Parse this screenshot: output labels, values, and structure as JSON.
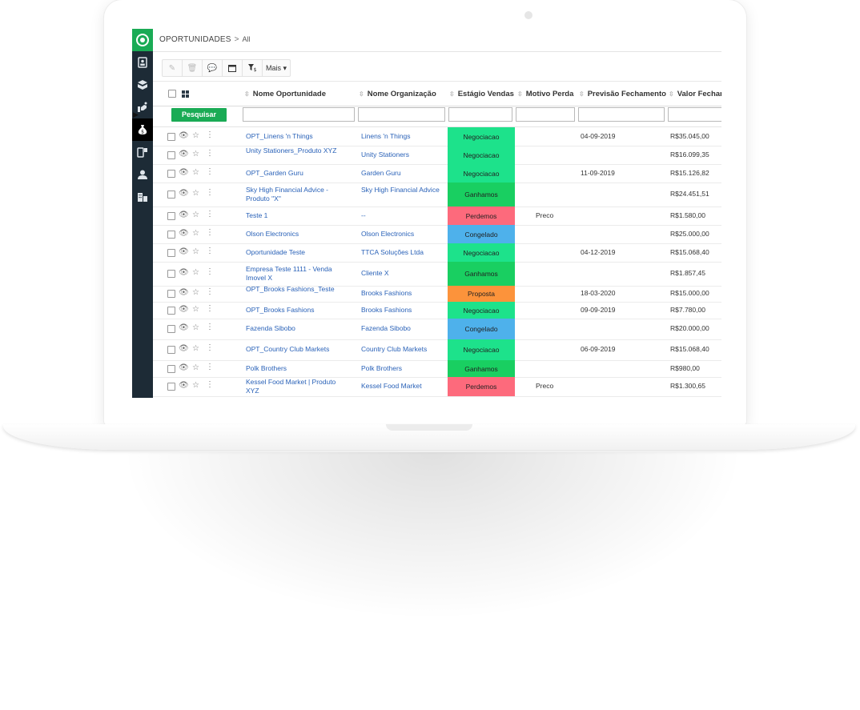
{
  "breadcrumb": {
    "main": "OPORTUNIDADES",
    "sep": ">",
    "sub": "All"
  },
  "toolbar": {
    "more_label": "Mais ▾"
  },
  "columns": [
    "Nome Oportunidade",
    "Nome Organização",
    "Estágio Vendas",
    "Motivo Perda",
    "Previsão Fechamento",
    "Valor Fechan"
  ],
  "filter": {
    "search_label": "Pesquisar"
  },
  "rows": [
    {
      "name": "OPT_Linens 'n Things",
      "org": "Linens 'n Things",
      "stage": "Negociacao",
      "reason": "",
      "date": "04-09-2019",
      "value": "R$35.045,00"
    },
    {
      "name": "Unity Stationers_Produto XYZ",
      "org": "Unity Stationers",
      "stage": "Negociacao",
      "reason": "",
      "date": "",
      "value": "R$16.099,35"
    },
    {
      "name": "OPT_Garden Guru",
      "org": "Garden Guru",
      "stage": "Negociacao",
      "reason": "",
      "date": "11-09-2019",
      "value": "R$15.126,82"
    },
    {
      "name": "Sky High Financial Advice - Produto \"X\"",
      "org": "Sky High Financial Advice",
      "stage": "Ganhamos",
      "reason": "",
      "date": "",
      "value": "R$24.451,51"
    },
    {
      "name": "Teste 1",
      "org": "--",
      "stage": "Perdemos",
      "reason": "Preco",
      "date": "",
      "value": "R$1.580,00"
    },
    {
      "name": "Olson Electronics",
      "org": "Olson Electronics",
      "stage": "Congelado",
      "reason": "",
      "date": "",
      "value": "R$25.000,00"
    },
    {
      "name": "Oportunidade Teste",
      "org": "TTCA Soluções Ltda",
      "stage": "Negociacao",
      "reason": "",
      "date": "04-12-2019",
      "value": "R$15.068,40"
    },
    {
      "name": "Empresa Teste 1111 - Venda Imovel X",
      "org": "Cliente X",
      "stage": "Ganhamos",
      "reason": "",
      "date": "",
      "value": "R$1.857,45"
    },
    {
      "name": "OPT_Brooks Fashions_Teste",
      "org": "Brooks Fashions",
      "stage": "Proposta",
      "reason": "",
      "date": "18-03-2020",
      "value": "R$15.000,00"
    },
    {
      "name": "OPT_Brooks Fashions",
      "org": "Brooks Fashions",
      "stage": "Negociacao",
      "reason": "",
      "date": "09-09-2019",
      "value": "R$7.780,00"
    },
    {
      "name": "Fazenda Sibobo",
      "org": "Fazenda Sibobo",
      "stage": "Congelado",
      "reason": "",
      "date": "",
      "value": "R$20.000,00"
    },
    {
      "name": "OPT_Country Club Markets",
      "org": "Country Club Markets",
      "stage": "Negociacao",
      "reason": "",
      "date": "06-09-2019",
      "value": "R$15.068,40"
    },
    {
      "name": "Polk Brothers",
      "org": "Polk Brothers",
      "stage": "Ganhamos",
      "reason": "",
      "date": "",
      "value": "R$980,00"
    },
    {
      "name": "Kessel Food Market | Produto XYZ",
      "org": "Kessel Food Market",
      "stage": "Perdemos",
      "reason": "Preco",
      "date": "",
      "value": "R$1.300,65"
    }
  ],
  "stage_colors": {
    "Negociacao": "#1de28b",
    "Ganhamos": "#19cf61",
    "Perdemos": "#fd6a7c",
    "Congelado": "#4eb1eb",
    "Proposta": "#fc933b"
  },
  "sidebar_icons": [
    "contacts-icon",
    "products-icon",
    "deals-icon",
    "money-bag-icon",
    "mobile-icon",
    "user-icon",
    "buildings-icon"
  ]
}
